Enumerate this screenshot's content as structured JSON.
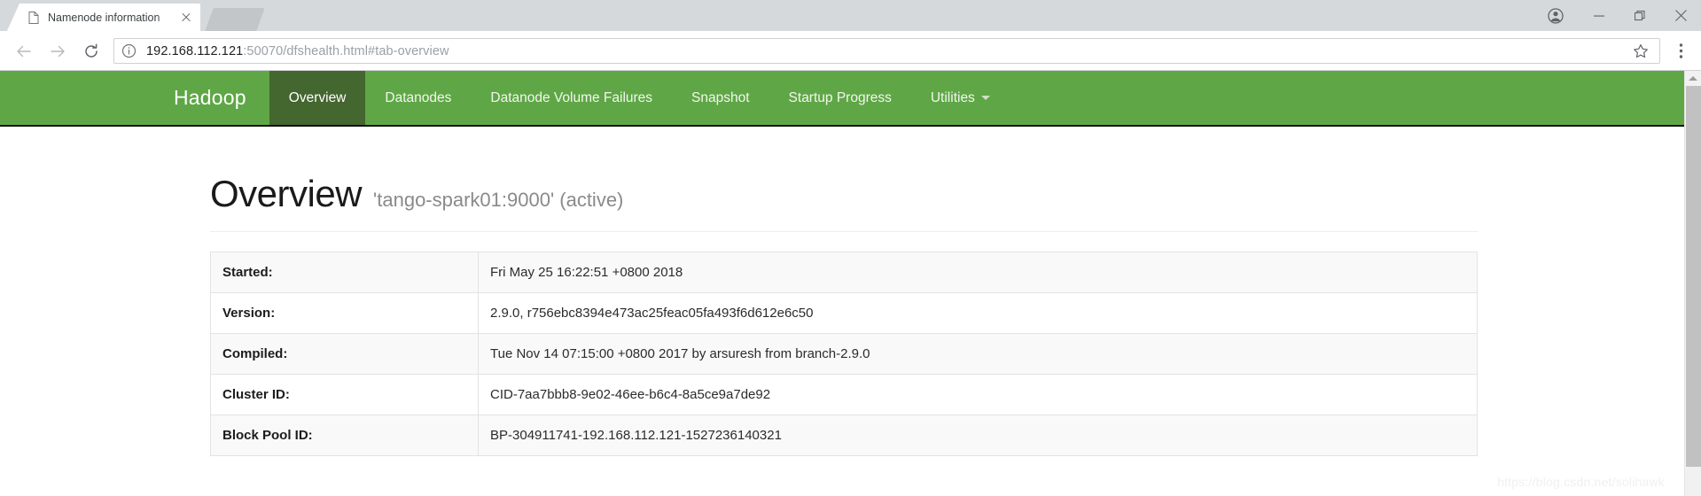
{
  "browser": {
    "tab": {
      "title": "Namenode information",
      "favicon": "page-icon",
      "close": "close-icon"
    },
    "new_tab_button": "new-tab-icon",
    "window_controls": {
      "profile": "profile-avatar-icon",
      "minimize": "minimize-icon",
      "maximize": "restore-icon",
      "close": "close-icon"
    },
    "toolbar": {
      "back": "back-arrow-icon",
      "forward": "forward-arrow-icon",
      "reload": "reload-icon",
      "site_info": "info-circle-icon",
      "url_host": "192.168.112.121",
      "url_path": ":50070/dfshealth.html#tab-overview",
      "bookmark": "star-icon",
      "menu": "three-dot-menu-icon"
    }
  },
  "hadoop": {
    "brand": "Hadoop",
    "nav": [
      {
        "label": "Overview",
        "active": true
      },
      {
        "label": "Datanodes",
        "active": false
      },
      {
        "label": "Datanode Volume Failures",
        "active": false
      },
      {
        "label": "Snapshot",
        "active": false
      },
      {
        "label": "Startup Progress",
        "active": false
      },
      {
        "label": "Utilities",
        "active": false,
        "caret": true
      }
    ],
    "navbar_color": "#5fa746",
    "navbar_active_color": "#44662f"
  },
  "overview": {
    "title": "Overview",
    "subtitle": "'tango-spark01:9000' (active)",
    "rows": [
      {
        "label": "Started:",
        "value": "Fri May 25 16:22:51 +0800 2018"
      },
      {
        "label": "Version:",
        "value": "2.9.0, r756ebc8394e473ac25feac05fa493f6d612e6c50"
      },
      {
        "label": "Compiled:",
        "value": "Tue Nov 14 07:15:00 +0800 2017 by arsuresh from branch-2.9.0"
      },
      {
        "label": "Cluster ID:",
        "value": "CID-7aa7bbb8-9e02-46ee-b6c4-8a5ce9a7de92"
      },
      {
        "label": "Block Pool ID:",
        "value": "BP-304911741-192.168.112.121-1527236140321"
      }
    ]
  },
  "watermark": "https://blog.csdn.net/solihawk"
}
